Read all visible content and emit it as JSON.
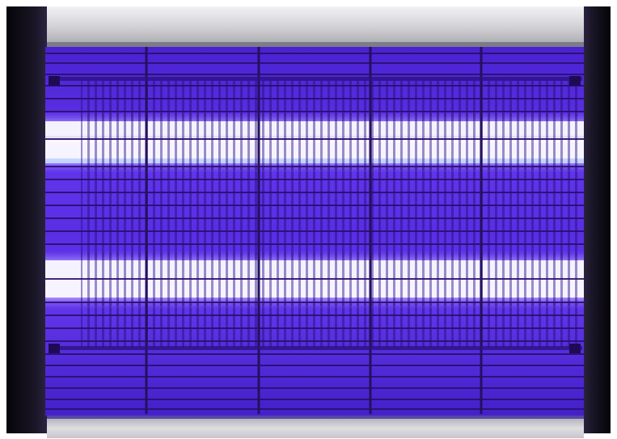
{
  "scene": {
    "subject": "uv-insect-zapper",
    "colors": {
      "uv_glow": "#5a2ee6",
      "uv_deep": "#3a16b8",
      "tube_core": "#ffffff",
      "tube_halo": "#bfd4ff",
      "grid_wire": "#2a0f70",
      "housing_dark": "#0e0c14",
      "housing_silver": "#d8d8dc",
      "housing_shadow": "#9a9aa2"
    },
    "uv_tube_count": 2,
    "support_bar_count": 4
  }
}
